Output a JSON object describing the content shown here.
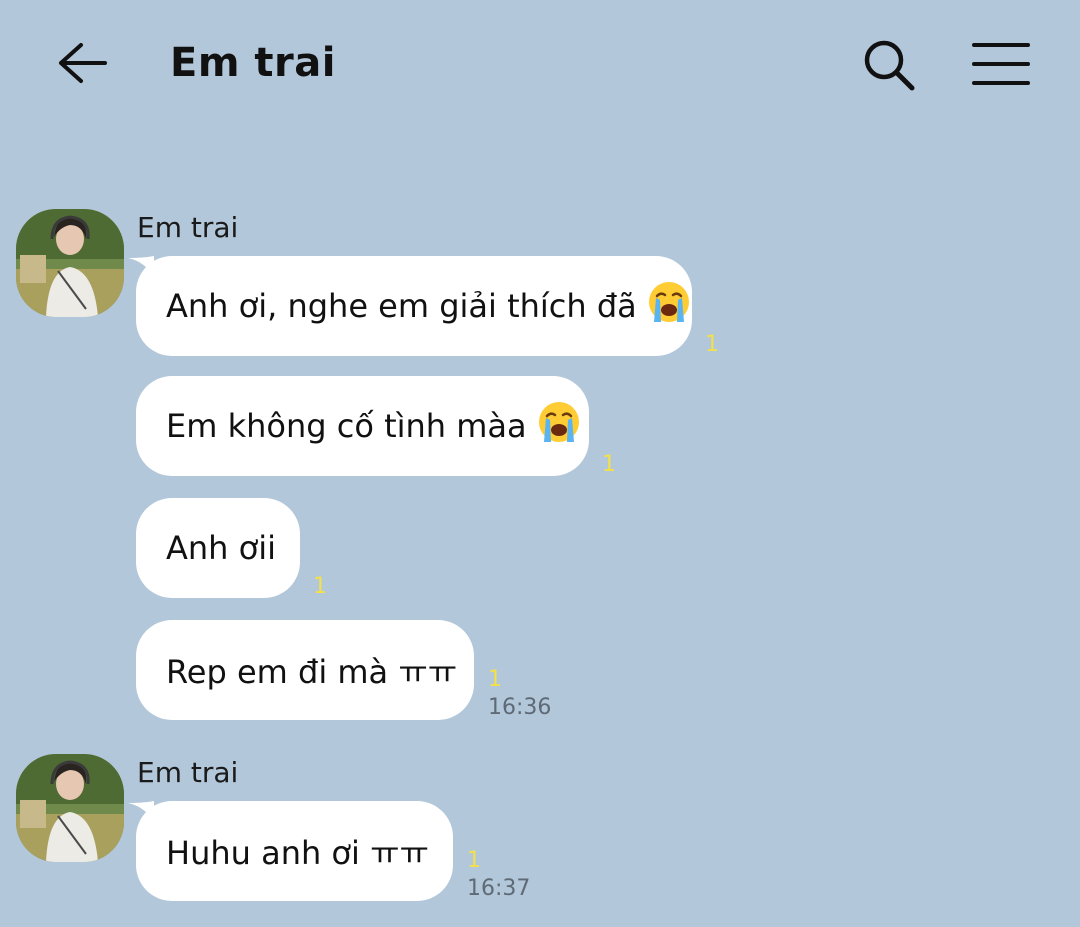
{
  "header": {
    "title": "Em trai",
    "back_icon": "arrow-left-icon",
    "search_icon": "search-icon",
    "menu_icon": "hamburger-menu-icon"
  },
  "colors": {
    "background": "#b2c7da",
    "bubble": "#ffffff",
    "unread": "#f3e04a",
    "time": "#5e6a75"
  },
  "groups": [
    {
      "sender": "Em trai",
      "messages": [
        {
          "text": "Anh ơi, nghe em giải thích đã",
          "emoji": "loudly-crying-face",
          "unread": "1",
          "time": ""
        },
        {
          "text": "Em không cố tình màa",
          "emoji": "loudly-crying-face",
          "unread": "1",
          "time": ""
        },
        {
          "text": "Anh ơii",
          "emoji": "",
          "unread": "1",
          "time": ""
        },
        {
          "text": "Rep em đi mà ㅠㅠ",
          "emoji": "",
          "unread": "1",
          "time": "16:36"
        }
      ]
    },
    {
      "sender": "Em trai",
      "messages": [
        {
          "text": "Huhu anh ơi ㅠㅠ",
          "emoji": "",
          "unread": "1",
          "time": "16:37"
        }
      ]
    }
  ]
}
